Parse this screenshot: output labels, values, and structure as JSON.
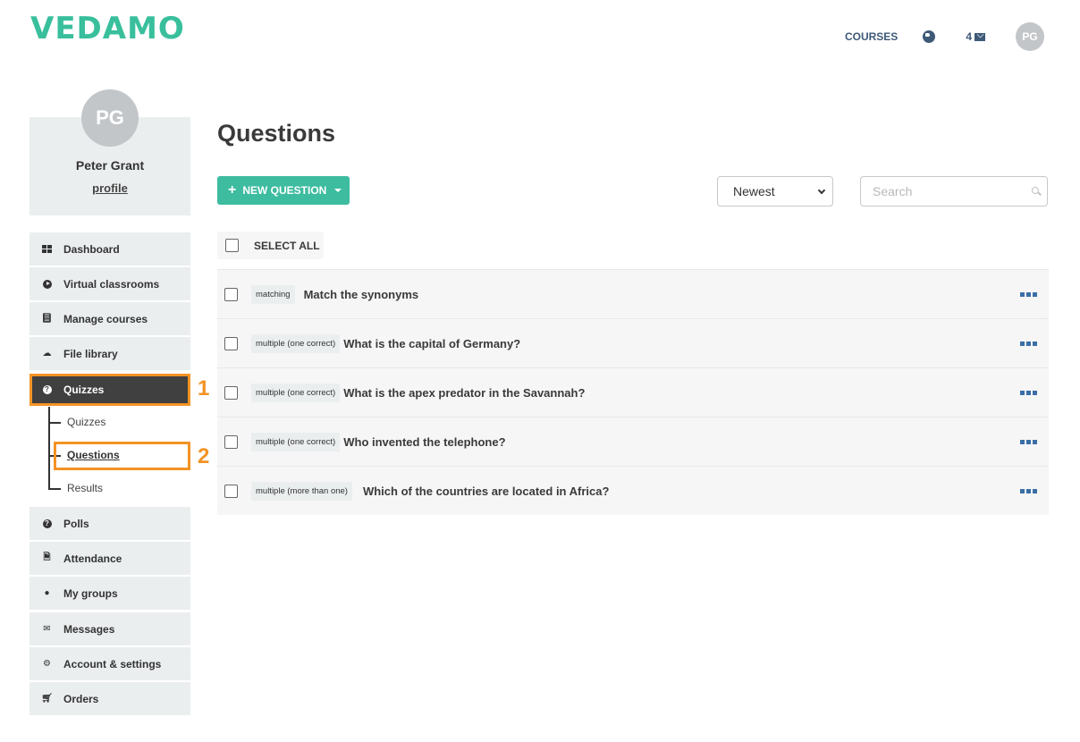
{
  "brand": {
    "logo_text": "VEDAMO",
    "accent_color": "#39bf9c"
  },
  "topnav": {
    "courses_label": "COURSES",
    "globe_icon": "globe-icon",
    "messages_count": "4",
    "messages_icon": "envelope-icon",
    "user_initials": "PG"
  },
  "profile": {
    "initials": "PG",
    "name": "Peter Grant",
    "profile_link": "profile"
  },
  "sidebar": {
    "items": [
      {
        "label": "Dashboard",
        "icon": "dashboard-grid-icon"
      },
      {
        "label": "Virtual classrooms",
        "icon": "play-circle-icon"
      },
      {
        "label": "Manage courses",
        "icon": "book-icon"
      },
      {
        "label": "File library",
        "icon": "cloud-upload-icon"
      },
      {
        "label": "Quizzes",
        "icon": "question-circle-icon",
        "active": true
      },
      {
        "label": "Polls",
        "icon": "question-circle-icon"
      },
      {
        "label": "Attendance",
        "icon": "document-icon"
      },
      {
        "label": "My groups",
        "icon": "users-icon"
      },
      {
        "label": "Messages",
        "icon": "envelope-icon"
      },
      {
        "label": "Account & settings",
        "icon": "gear-icon"
      },
      {
        "label": "Orders",
        "icon": "cart-icon"
      }
    ],
    "quizzes_submenu": [
      {
        "label": "Quizzes"
      },
      {
        "label": "Questions",
        "current": true
      },
      {
        "label": "Results"
      }
    ]
  },
  "annotations": {
    "step1": "1",
    "step2": "2",
    "highlight_color": "#f39325"
  },
  "main": {
    "title": "Questions",
    "new_question_label": "NEW QUESTION",
    "sort": {
      "selected": "Newest"
    },
    "search": {
      "placeholder": "Search",
      "value": ""
    },
    "select_all_label": "SELECT ALL",
    "questions": [
      {
        "type": "matching",
        "text": "Match the synonyms"
      },
      {
        "type": "multiple (one correct)",
        "text": "What is the capital of Germany?"
      },
      {
        "type": "multiple (one correct)",
        "text": "What is the apex predator in the Savannah?"
      },
      {
        "type": "multiple (one correct)",
        "text": "Who invented the telephone?"
      },
      {
        "type": "multiple (more than one)",
        "text": "Which of the countries are located in Africa?"
      }
    ]
  }
}
